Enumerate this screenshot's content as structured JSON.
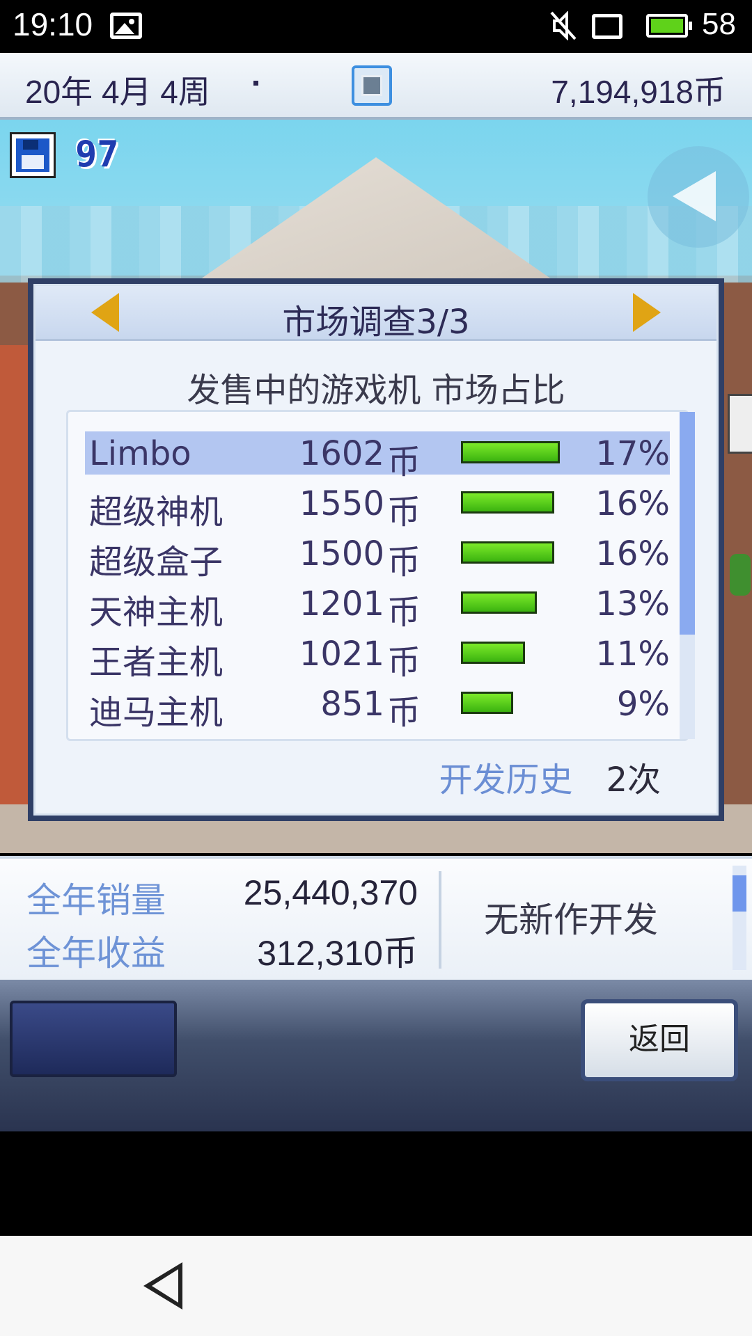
{
  "status_bar": {
    "time": "19:10",
    "icons": [
      "image-icon",
      "mute-icon",
      "sim-card-icon",
      "battery-icon"
    ],
    "battery_level": "58"
  },
  "hud": {
    "date": "20年 4月 4周",
    "money": "7,194,918币",
    "save_count": "97"
  },
  "market_panel": {
    "title": "市场调查3/3",
    "subtitle": "发售中的游戏机 市场占比",
    "rows": [
      {
        "name": "Limbo",
        "price": "1602",
        "unit": "币",
        "share": "17%",
        "share_value": 0.17,
        "selected": true
      },
      {
        "name": "超级神机",
        "price": "1550",
        "unit": "币",
        "share": "16%",
        "share_value": 0.16
      },
      {
        "name": "超级盒子",
        "price": "1500",
        "unit": "币",
        "share": "16%",
        "share_value": 0.16
      },
      {
        "name": "天神主机",
        "price": "1201",
        "unit": "币",
        "share": "13%",
        "share_value": 0.13
      },
      {
        "name": "王者主机",
        "price": "1021",
        "unit": "币",
        "share": "11%",
        "share_value": 0.11
      },
      {
        "name": "迪马主机",
        "price": "851",
        "unit": "币",
        "share": "9%",
        "share_value": 0.09
      }
    ],
    "history_label": "开发历史",
    "history_value": "2次"
  },
  "stats": {
    "annual_sales_label": "全年销量",
    "annual_sales_value": "25,440,370",
    "annual_revenue_label": "全年收益",
    "annual_revenue_value": "312,310币",
    "status_text": "无新作开发"
  },
  "bottom_bar": {
    "back_label": "返回"
  },
  "colors": {
    "bar_green": "#5fd21a",
    "selected_row": "#b3c6f1",
    "label_blue": "#6e93d6",
    "arrow_gold": "#e0a414"
  }
}
